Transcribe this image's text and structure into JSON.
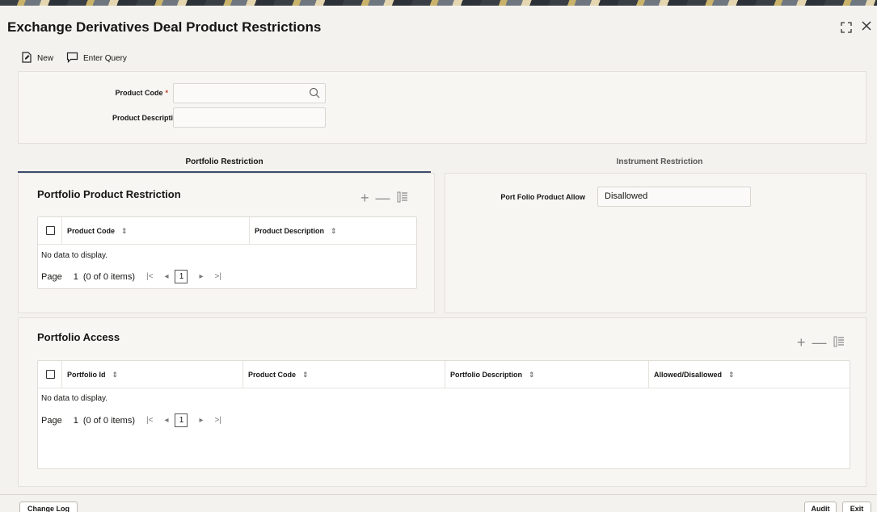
{
  "window": {
    "title": "Exchange Derivatives Deal Product Restrictions",
    "resize_icon": "resize-icon",
    "close_icon": "close-icon"
  },
  "toolbar": {
    "new_label": "New",
    "enter_query_label": "Enter Query"
  },
  "header_form": {
    "product_code_label": "Product Code",
    "product_code_required": "*",
    "product_code_value": "",
    "product_description_label": "Product Description",
    "product_description_value": ""
  },
  "tabs": [
    {
      "label": "Portfolio Restriction",
      "active": true
    },
    {
      "label": "Instrument Restriction",
      "active": false
    }
  ],
  "portfolio_product_restriction": {
    "title": "Portfolio Product Restriction",
    "columns": [
      "Product Code",
      "Product Description"
    ],
    "empty_text": "No data to display.",
    "pager": {
      "page_label": "Page",
      "page_num": "1",
      "info": "(0 of 0 items)",
      "current": "1"
    }
  },
  "instrument_panel": {
    "port_folio_label": "Port Folio Product Allow",
    "port_folio_value": "Disallowed"
  },
  "portfolio_access": {
    "title": "Portfolio Access",
    "columns": [
      "Portfolio Id",
      "Product Code",
      "Portfolio Description",
      "Allowed/Disallowed"
    ],
    "empty_text": "No data to display.",
    "pager": {
      "page_label": "Page",
      "page_num": "1",
      "info": "(0 of 0 items)",
      "current": "1"
    }
  },
  "footer": {
    "change_log_label": "Change Log",
    "audit_label": "Audit",
    "exit_label": "Exit"
  },
  "icons": {
    "sort": "⇕",
    "add": "+",
    "remove": "—",
    "columns": "☰"
  }
}
